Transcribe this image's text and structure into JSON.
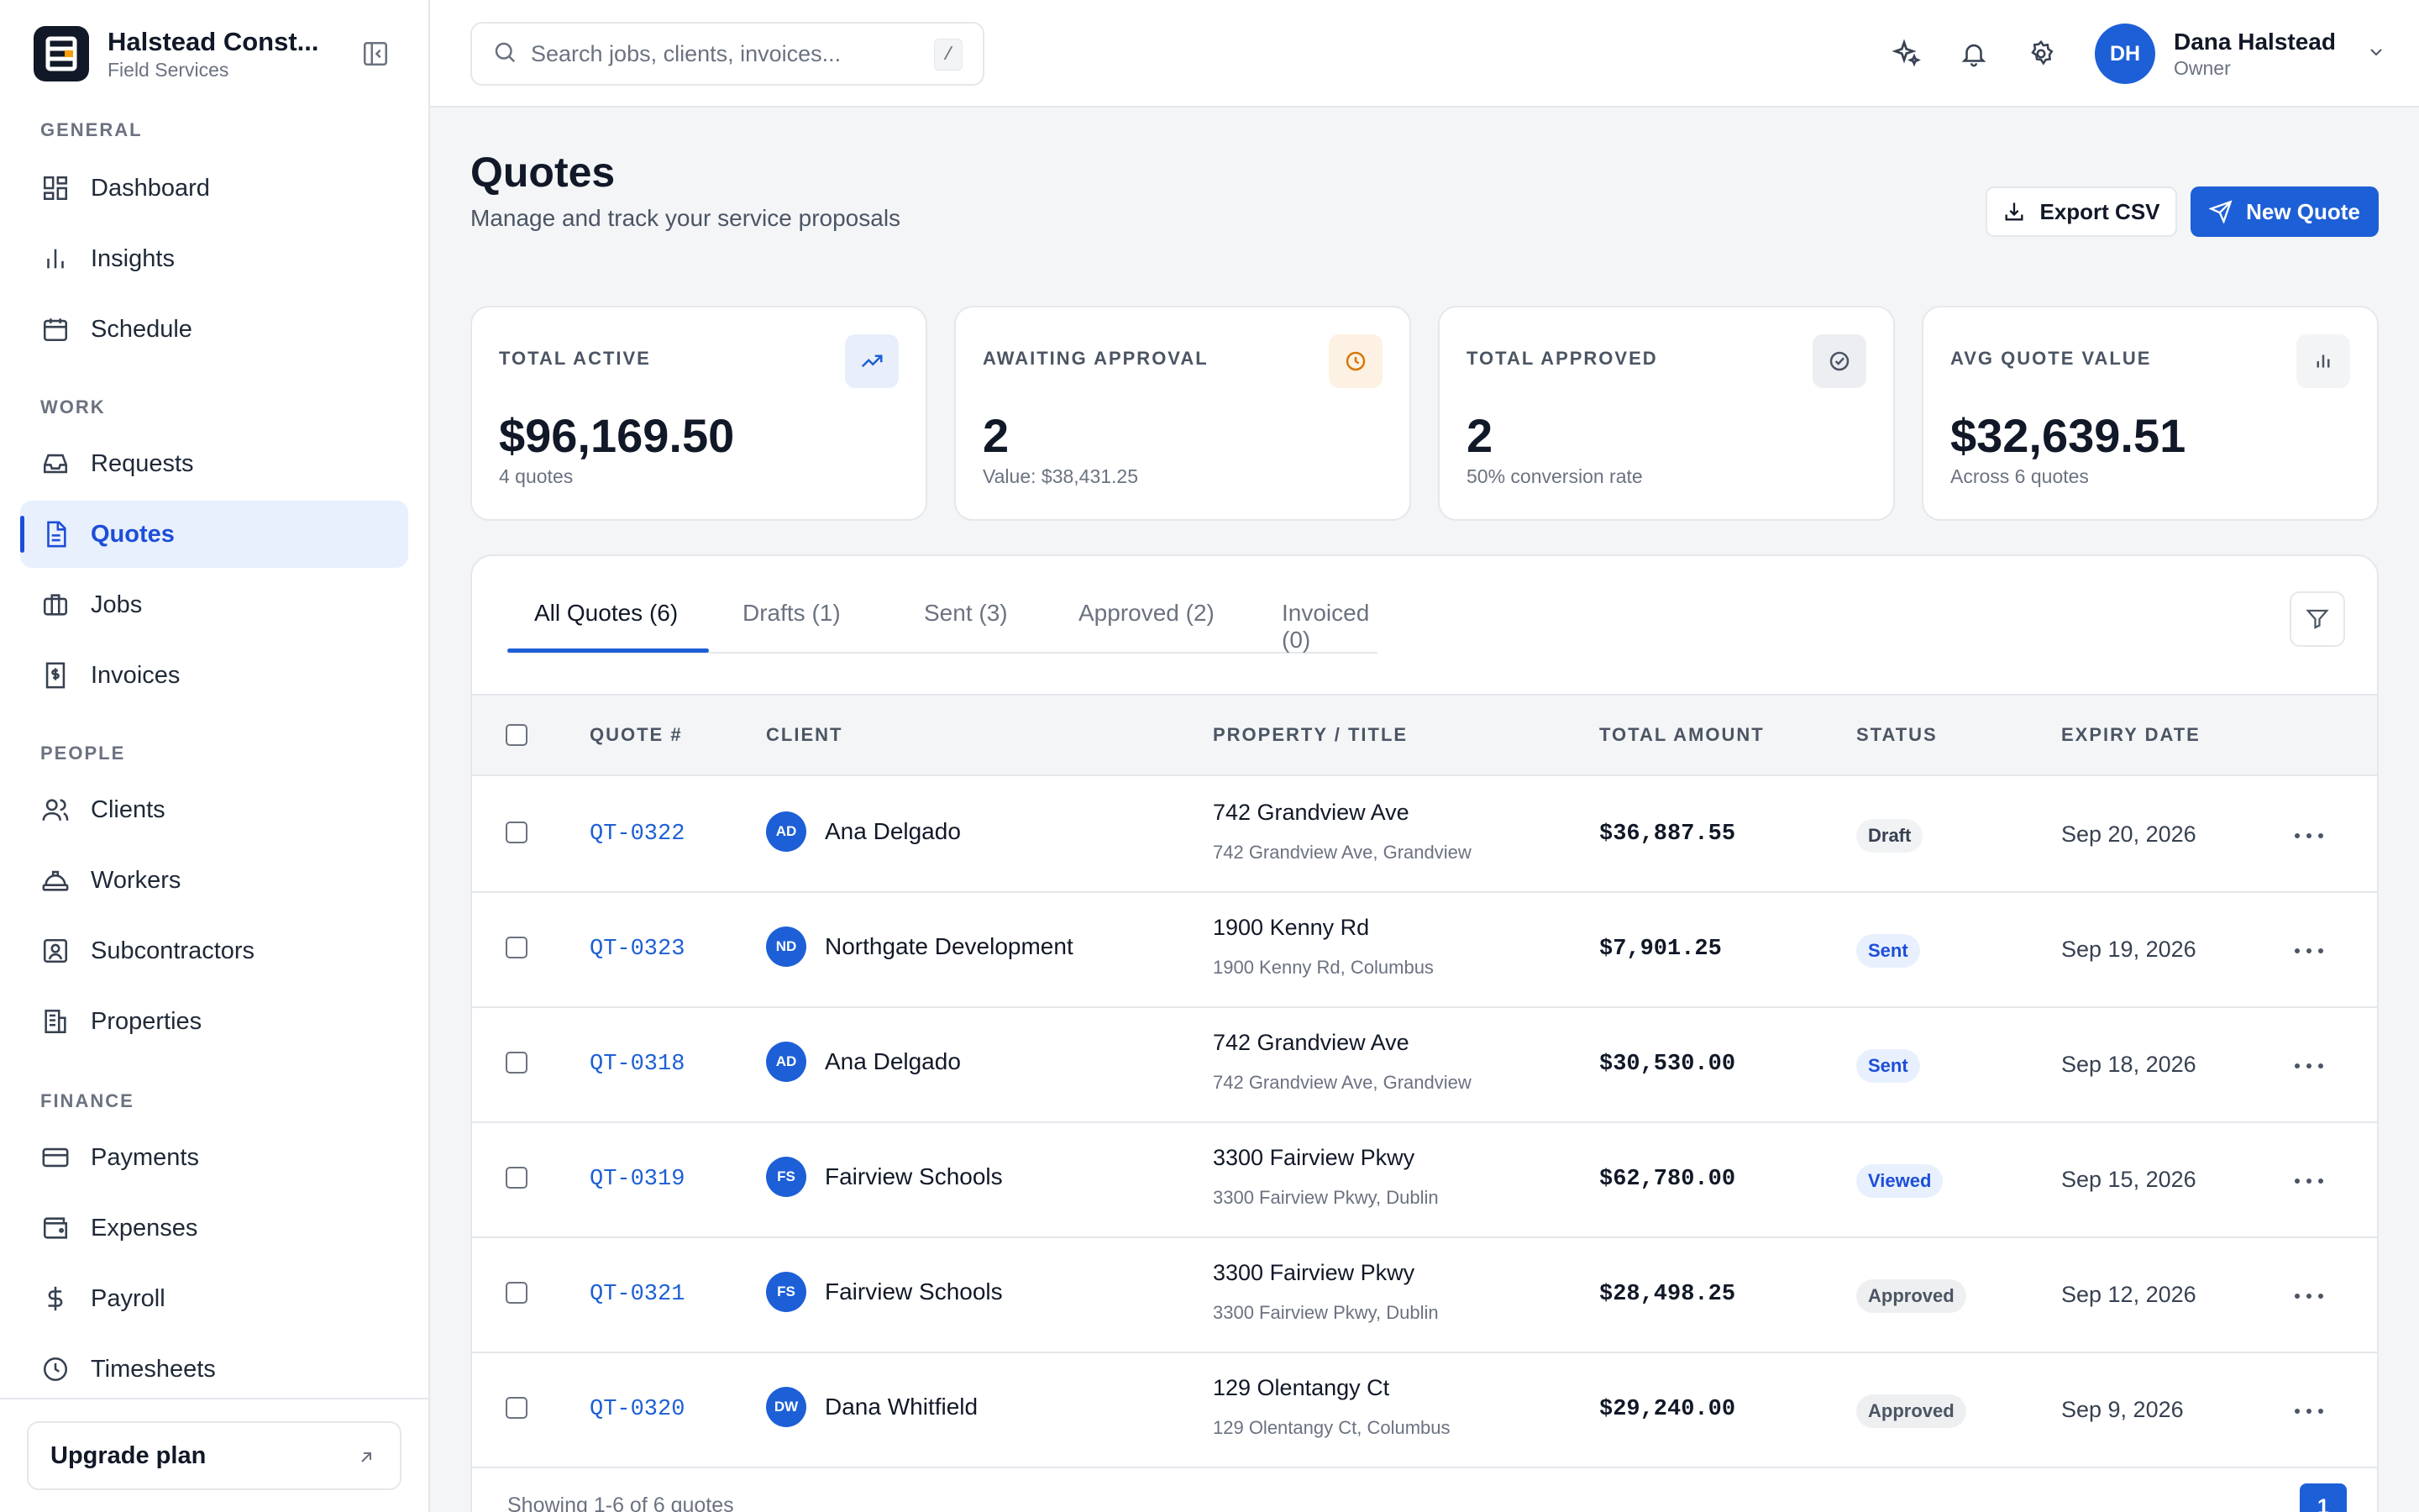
{
  "brand": {
    "name": "Halstead Const...",
    "subtitle": "Field Services"
  },
  "sidebar": {
    "sections": [
      {
        "title": "GENERAL",
        "items": [
          {
            "label": "Dashboard",
            "icon": "dashboard-icon"
          },
          {
            "label": "Insights",
            "icon": "chart-icon"
          },
          {
            "label": "Schedule",
            "icon": "calendar-icon"
          }
        ]
      },
      {
        "title": "WORK",
        "items": [
          {
            "label": "Requests",
            "icon": "inbox-icon"
          },
          {
            "label": "Quotes",
            "icon": "document-icon",
            "active": true
          },
          {
            "label": "Jobs",
            "icon": "briefcase-icon"
          },
          {
            "label": "Invoices",
            "icon": "invoice-icon"
          }
        ]
      },
      {
        "title": "PEOPLE",
        "items": [
          {
            "label": "Clients",
            "icon": "users-icon"
          },
          {
            "label": "Workers",
            "icon": "hardhat-icon"
          },
          {
            "label": "Subcontractors",
            "icon": "contact-icon"
          },
          {
            "label": "Properties",
            "icon": "building-icon"
          }
        ]
      },
      {
        "title": "FINANCE",
        "items": [
          {
            "label": "Payments",
            "icon": "credit-card-icon"
          },
          {
            "label": "Expenses",
            "icon": "wallet-icon"
          },
          {
            "label": "Payroll",
            "icon": "dollar-icon"
          },
          {
            "label": "Timesheets",
            "icon": "clock-icon"
          }
        ]
      }
    ],
    "upgrade_label": "Upgrade plan"
  },
  "search": {
    "placeholder": "Search jobs, clients, invoices...",
    "shortcut": "/"
  },
  "user": {
    "initials": "DH",
    "name": "Dana Halstead",
    "role": "Owner"
  },
  "page": {
    "title": "Quotes",
    "subtitle": "Manage and track your service proposals",
    "export_label": "Export CSV",
    "new_label": "New Quote"
  },
  "stats": [
    {
      "label": "TOTAL ACTIVE",
      "value": "$96,169.50",
      "sub": "4 quotes",
      "icon": "trend-up-icon"
    },
    {
      "label": "AWAITING APPROVAL",
      "value": "2",
      "sub": "Value: $38,431.25",
      "icon": "clock-icon"
    },
    {
      "label": "TOTAL APPROVED",
      "value": "2",
      "sub": "50% conversion rate",
      "icon": "check-circle-icon"
    },
    {
      "label": "AVG QUOTE VALUE",
      "value": "$32,639.51",
      "sub": "Across 6 quotes",
      "icon": "bar-chart-icon"
    }
  ],
  "tabs": [
    "All Quotes (6)",
    "Drafts (1)",
    "Sent (3)",
    "Approved (2)",
    "Invoiced (0)"
  ],
  "table": {
    "headers": [
      "QUOTE #",
      "CLIENT",
      "PROPERTY / TITLE",
      "TOTAL AMOUNT",
      "STATUS",
      "EXPIRY DATE"
    ],
    "rows": [
      {
        "quote": "QT-0322",
        "initials": "AD",
        "client": "Ana Delgado",
        "title": "742 Grandview Ave",
        "address": "742 Grandview Ave, Grandview",
        "amount": "$36,887.55",
        "status": "Draft",
        "status_kind": "draft",
        "expiry": "Sep 20, 2026"
      },
      {
        "quote": "QT-0323",
        "initials": "ND",
        "client": "Northgate Development",
        "title": "1900 Kenny Rd",
        "address": "1900 Kenny Rd, Columbus",
        "amount": "$7,901.25",
        "status": "Sent",
        "status_kind": "sent",
        "expiry": "Sep 19, 2026"
      },
      {
        "quote": "QT-0318",
        "initials": "AD",
        "client": "Ana Delgado",
        "title": "742 Grandview Ave",
        "address": "742 Grandview Ave, Grandview",
        "amount": "$30,530.00",
        "status": "Sent",
        "status_kind": "sent",
        "expiry": "Sep 18, 2026"
      },
      {
        "quote": "QT-0319",
        "initials": "FS",
        "client": "Fairview Schools",
        "title": "3300 Fairview Pkwy",
        "address": "3300 Fairview Pkwy, Dublin",
        "amount": "$62,780.00",
        "status": "Viewed",
        "status_kind": "viewed",
        "expiry": "Sep 15, 2026"
      },
      {
        "quote": "QT-0321",
        "initials": "FS",
        "client": "Fairview Schools",
        "title": "3300 Fairview Pkwy",
        "address": "3300 Fairview Pkwy, Dublin",
        "amount": "$28,498.25",
        "status": "Approved",
        "status_kind": "approved",
        "expiry": "Sep 12, 2026"
      },
      {
        "quote": "QT-0320",
        "initials": "DW",
        "client": "Dana Whitfield",
        "title": "129 Olentangy Ct",
        "address": "129 Olentangy Ct, Columbus",
        "amount": "$29,240.00",
        "status": "Approved",
        "status_kind": "approved",
        "expiry": "Sep 9, 2026"
      }
    ],
    "footer": "Showing 1-6 of 6 quotes",
    "page": "1"
  },
  "colors": {
    "accent": "#1d5fd6",
    "accent_soft": "#e8f0fd",
    "warning": "#d97706"
  }
}
